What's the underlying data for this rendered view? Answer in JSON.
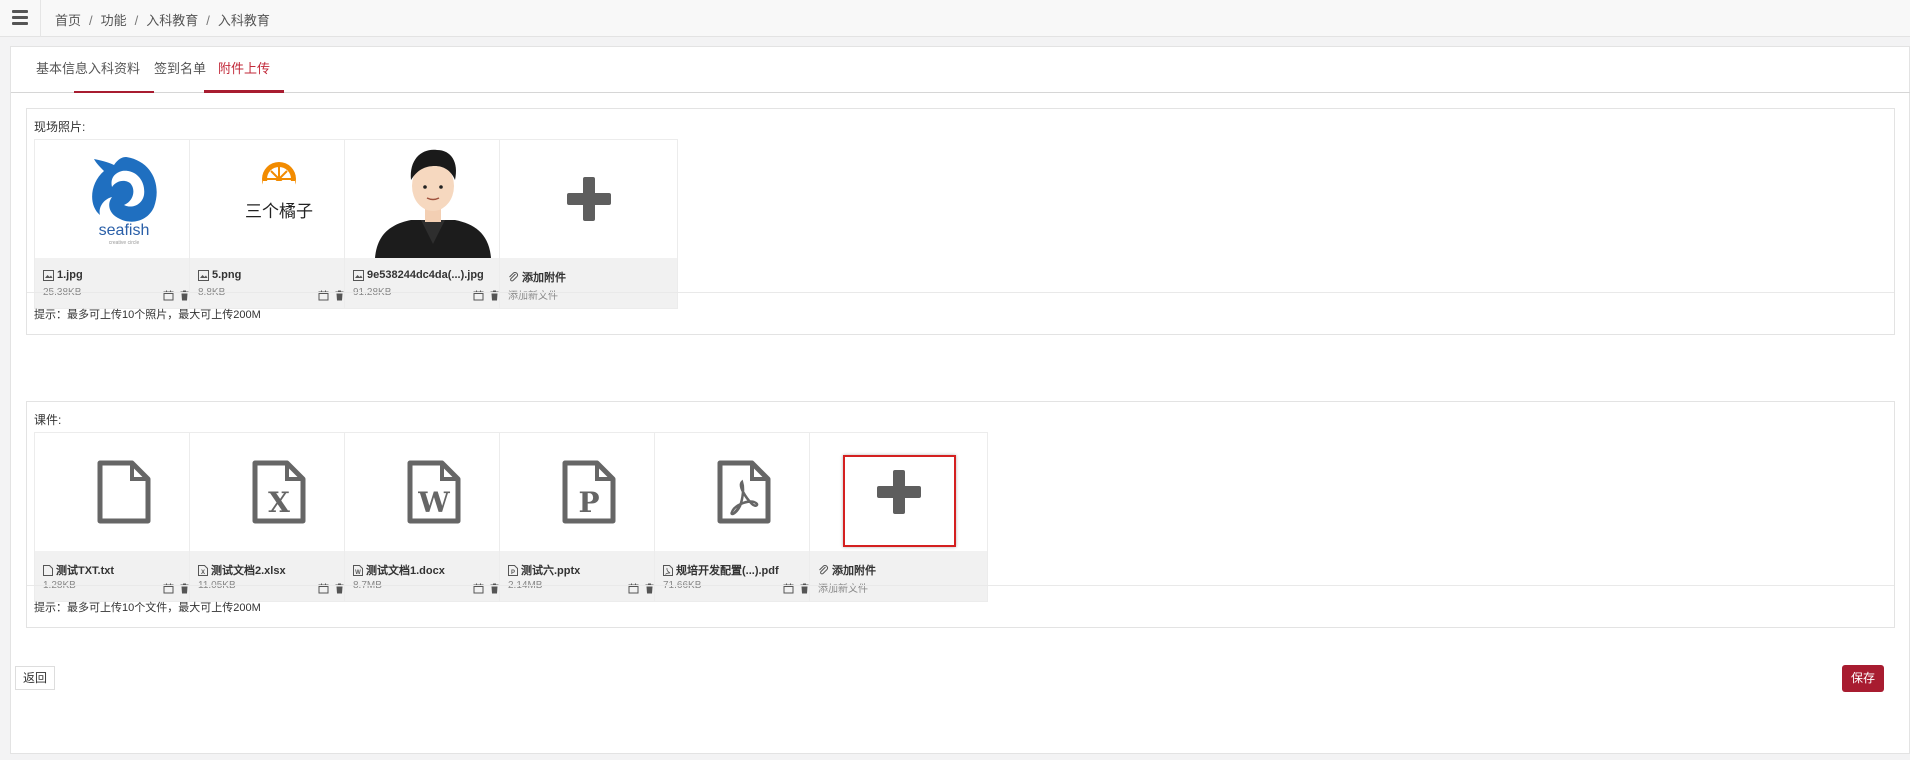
{
  "breadcrumb": [
    "首页",
    "功能",
    "入科教育",
    "入科教育"
  ],
  "tabs": [
    {
      "label": "基本信息"
    },
    {
      "label": "入科资料"
    },
    {
      "label": "签到名单"
    },
    {
      "label": "附件上传"
    }
  ],
  "photos": {
    "title": "现场照片:",
    "items": [
      {
        "name": "1.jpg",
        "size": "25.38KB",
        "image": "seafish-logo",
        "logo_text": "seafish",
        "logo_sub": "creative circle"
      },
      {
        "name": "5.png",
        "size": "8.8KB",
        "image": "orange-logo",
        "logo_text": "三个橘子"
      },
      {
        "name": "9e538244dc4da(...).jpg",
        "size": "91.28KB",
        "image": "avatar-illustration"
      }
    ],
    "add": {
      "label": "添加附件",
      "sub": "添加新文件"
    },
    "tip": "提示：最多可上传10个照片，最大可上传200M"
  },
  "courseware": {
    "title": "课件:",
    "items": [
      {
        "name": "测试TXT.txt",
        "size": "1.28KB",
        "icon": "file-icon"
      },
      {
        "name": "测试文档2.xlsx",
        "size": "11.05KB",
        "icon": "excel-file-icon"
      },
      {
        "name": "测试文档1.docx",
        "size": "8.7MB",
        "icon": "word-file-icon"
      },
      {
        "name": "测试六.pptx",
        "size": "2.14MB",
        "icon": "powerpoint-file-icon"
      },
      {
        "name": "规培开发配置(...).pdf",
        "size": "71.66KB",
        "icon": "pdf-file-icon"
      }
    ],
    "add": {
      "label": "添加附件",
      "sub": "添加新文件"
    },
    "tip": "提示：最多可上传10个文件，最大可上传200M"
  },
  "buttons": {
    "back": "返回",
    "save": "保存"
  },
  "colors": {
    "accent": "#a81c30",
    "highlight": "#d42020"
  }
}
